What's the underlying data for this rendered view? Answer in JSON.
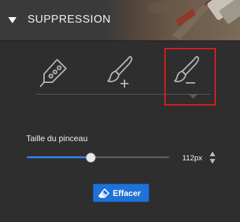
{
  "panel": {
    "title": "SUPPRESSION",
    "expanded": true
  },
  "tools": [
    {
      "name": "cutter-icon",
      "selected": false
    },
    {
      "name": "brush-plus-icon",
      "selected": false
    },
    {
      "name": "brush-minus-icon",
      "selected": true
    }
  ],
  "brush_size": {
    "label": "Taille du pinceau",
    "value_text": "112px",
    "fraction": 0.45
  },
  "erase_button": {
    "label": "Effacer",
    "icon": "eraser-icon"
  },
  "colors": {
    "background": "#2e2e2e",
    "accent": "#2f7de1",
    "button": "#1f72d8",
    "highlight": "#e21b1b"
  }
}
